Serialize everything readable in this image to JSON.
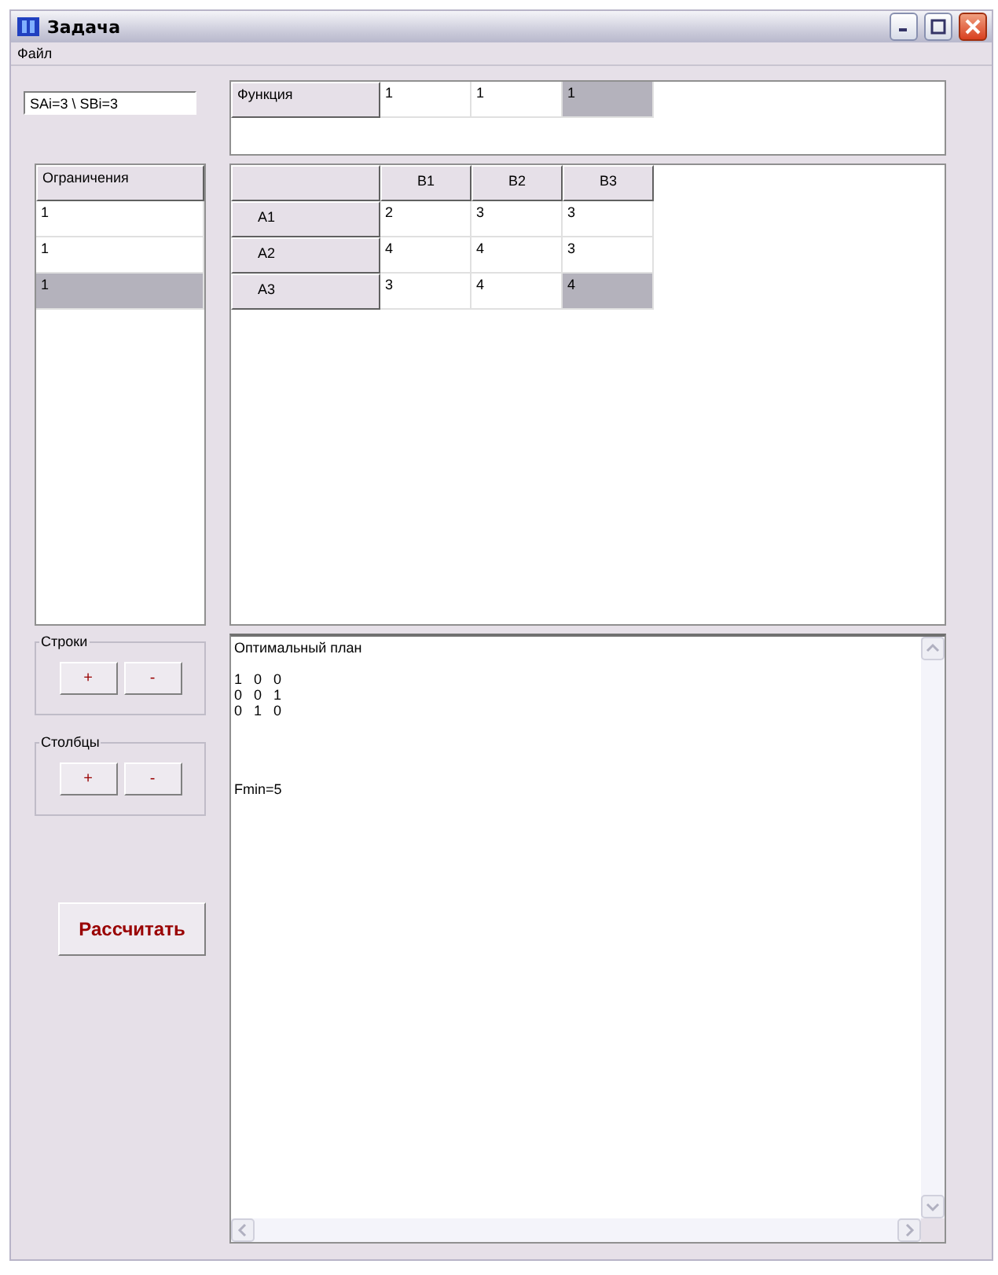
{
  "window": {
    "title": "Задача"
  },
  "menu": [
    {
      "label": "Файл"
    }
  ],
  "summary_field": {
    "value": "SAi=3 \\ SBi=3"
  },
  "function_grid": {
    "header": "Функция",
    "cells": [
      {
        "value": "1",
        "selected": false
      },
      {
        "value": "1",
        "selected": false
      },
      {
        "value": "1",
        "selected": true
      }
    ]
  },
  "constraints": {
    "header": "Ограничения",
    "cells": [
      {
        "value": "1",
        "selected": false
      },
      {
        "value": "1",
        "selected": false
      },
      {
        "value": "1",
        "selected": true
      }
    ]
  },
  "matrix": {
    "columns": [
      "B1",
      "B2",
      "B3"
    ],
    "rows": [
      {
        "label": "A1",
        "cells": [
          {
            "value": "2",
            "selected": false
          },
          {
            "value": "3",
            "selected": false
          },
          {
            "value": "3",
            "selected": false
          }
        ]
      },
      {
        "label": "A2",
        "cells": [
          {
            "value": "4",
            "selected": false
          },
          {
            "value": "4",
            "selected": false
          },
          {
            "value": "3",
            "selected": false
          }
        ]
      },
      {
        "label": "A3",
        "cells": [
          {
            "value": "3",
            "selected": false
          },
          {
            "value": "4",
            "selected": false
          },
          {
            "value": "4",
            "selected": true
          }
        ]
      }
    ]
  },
  "groups": [
    {
      "title": "Строки",
      "buttons": [
        "+",
        "-"
      ]
    },
    {
      "title": "Столбцы",
      "buttons": [
        "+",
        "-"
      ]
    }
  ],
  "calculate_button": {
    "label": "Рассчитать"
  },
  "output": {
    "blocks": [
      {
        "lines": [
          "Оптимальный план"
        ]
      },
      {
        "lines": [
          "1   0   0",
          "0   0   1",
          "0   1   0"
        ]
      },
      {
        "lines": [
          "Fmin=5"
        ]
      }
    ]
  }
}
